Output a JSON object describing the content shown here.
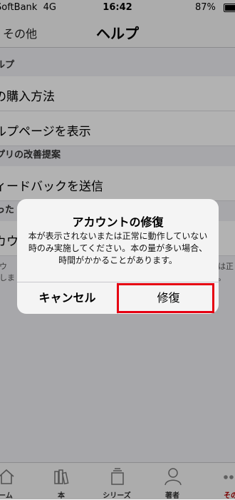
{
  "status_bar": {
    "carrier": "SoftBank",
    "network": "4G",
    "time": "16:42",
    "battery": "87%"
  },
  "nav": {
    "back_label": "その他",
    "title": "ヘルプ"
  },
  "list": {
    "section_help": "ルプ",
    "rows_help": [
      "の購入方法",
      "ルプページを表示"
    ],
    "section_improve": "プリの改善提案",
    "rows_improve": [
      "ィードバックを送信"
    ],
    "section_other": "った",
    "rows_other": [
      "カウ"
    ],
    "footnote_left": [
      "カウ",
      "作しま"
    ],
    "footnote_right": [
      "は正",
      "。"
    ]
  },
  "alert": {
    "title": "アカウントの修復",
    "message": "本が表示されないまたは正常に動作していない時のみ実施してください。本の量が多い場合、時間がかかることがあります。",
    "cancel_label": "キャンセル",
    "confirm_label": "修復"
  },
  "tabbar": {
    "items": [
      {
        "label": "ーム",
        "icon": "home-icon"
      },
      {
        "label": "本",
        "icon": "books-icon"
      },
      {
        "label": "シリーズ",
        "icon": "series-icon"
      },
      {
        "label": "著者",
        "icon": "author-icon"
      },
      {
        "label": "その",
        "icon": "more-icon"
      }
    ],
    "active_color": "#b00000"
  },
  "colors": {
    "highlight": "#e60012"
  }
}
